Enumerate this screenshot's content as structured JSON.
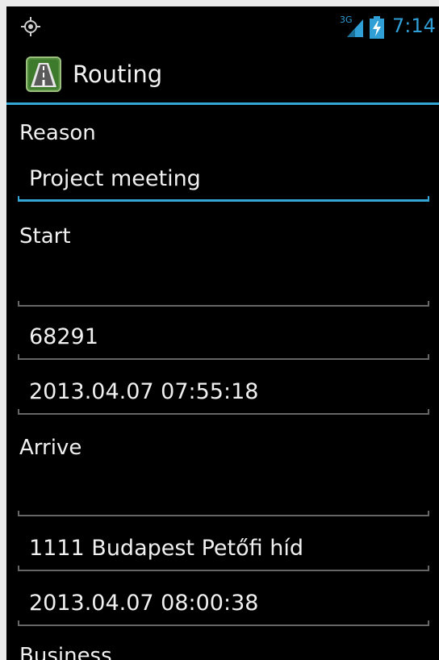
{
  "status_bar": {
    "network_type": "3G",
    "time": "7:14"
  },
  "action_bar": {
    "title": "Routing",
    "app_icon": "highway-road-icon"
  },
  "form": {
    "reason_label": "Reason",
    "reason_value": "Project meeting",
    "start_label": "Start",
    "start_name": "",
    "start_code": "68291",
    "start_time": "2013.04.07 07:55:18",
    "arrive_label": "Arrive",
    "arrive_name": "",
    "arrive_address": "1111 Budapest Petőfi híd",
    "arrive_time": "2013.04.07 08:00:38",
    "business_label": "Business"
  },
  "colors": {
    "accent": "#33a6d6",
    "background": "#000000",
    "divider": "#666666"
  }
}
